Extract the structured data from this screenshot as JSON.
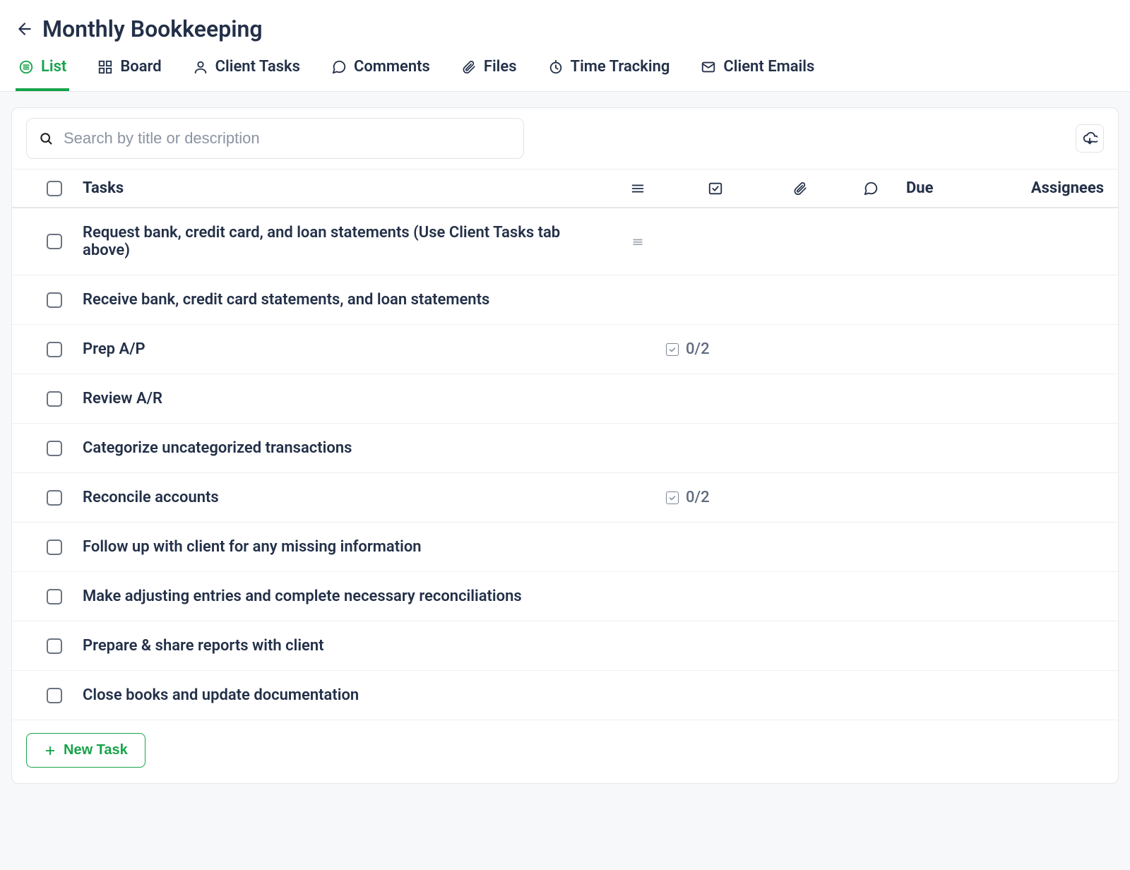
{
  "header": {
    "title": "Monthly Bookkeeping"
  },
  "tabs": [
    {
      "label": "List",
      "active": true,
      "icon": "list-icon"
    },
    {
      "label": "Board",
      "active": false,
      "icon": "board-icon"
    },
    {
      "label": "Client Tasks",
      "active": false,
      "icon": "user-icon"
    },
    {
      "label": "Comments",
      "active": false,
      "icon": "chat-icon"
    },
    {
      "label": "Files",
      "active": false,
      "icon": "attachment-icon"
    },
    {
      "label": "Time Tracking",
      "active": false,
      "icon": "clock-icon"
    },
    {
      "label": "Client Emails",
      "active": false,
      "icon": "mail-icon"
    }
  ],
  "search": {
    "placeholder": "Search by title or description"
  },
  "columns": {
    "tasks": "Tasks",
    "due": "Due",
    "assignees": "Assignees"
  },
  "rows": [
    {
      "title": "Request bank, credit card, and loan statements (Use Client Tasks tab above)",
      "has_handle": true,
      "subtasks": ""
    },
    {
      "title": "Receive bank, credit card statements, and loan statements",
      "has_handle": false,
      "subtasks": ""
    },
    {
      "title": "Prep A/P",
      "has_handle": false,
      "subtasks": "0/2"
    },
    {
      "title": "Review A/R",
      "has_handle": false,
      "subtasks": ""
    },
    {
      "title": "Categorize uncategorized transactions",
      "has_handle": false,
      "subtasks": ""
    },
    {
      "title": "Reconcile accounts",
      "has_handle": false,
      "subtasks": "0/2"
    },
    {
      "title": "Follow up with client for any missing information",
      "has_handle": false,
      "subtasks": ""
    },
    {
      "title": "Make adjusting entries and complete necessary reconciliations",
      "has_handle": false,
      "subtasks": ""
    },
    {
      "title": "Prepare & share reports with client",
      "has_handle": false,
      "subtasks": ""
    },
    {
      "title": "Close books and update documentation",
      "has_handle": false,
      "subtasks": ""
    }
  ],
  "footer": {
    "new_task_label": "New Task"
  }
}
